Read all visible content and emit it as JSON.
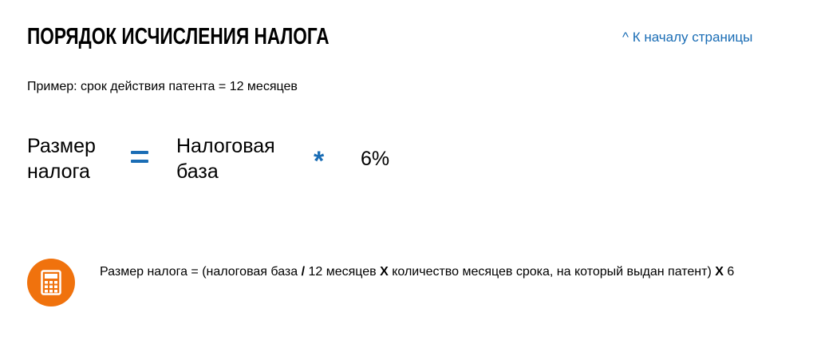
{
  "header": {
    "title": "ПОРЯДОК ИСЧИСЛЕНИЯ НАЛОГА",
    "top_link": "^ К началу страницы"
  },
  "example": {
    "text": "Пример: срок действия патента = 12 месяцев"
  },
  "formula": {
    "term_tax_line1": "Размер",
    "term_tax_line2": "налога",
    "equals_sign": "=",
    "term_base_line1": "Налоговая",
    "term_base_line2": "база",
    "multiply_sign": "*",
    "rate": "6%"
  },
  "calculation": {
    "icon": "calculator-icon",
    "part1": "Размер налога = (налоговая база ",
    "op1": "/",
    "part2": " 12 месяцев ",
    "op2": "X",
    "part3": " количество месяцев срока, на который выдан патент) ",
    "op3": "X",
    "part4": " 6"
  },
  "colors": {
    "accent_blue": "#1a6db5",
    "icon_orange": "#f0720d"
  }
}
